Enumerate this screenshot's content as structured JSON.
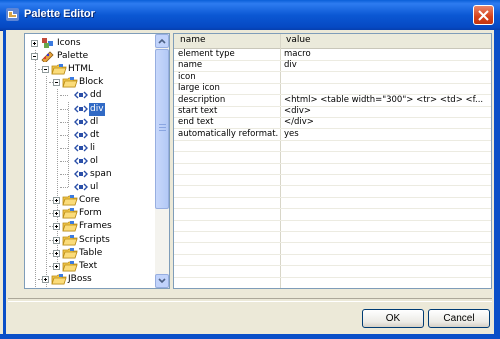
{
  "window": {
    "title": "Palette Editor"
  },
  "tree": {
    "items": [
      {
        "label": "Icons"
      },
      {
        "label": "Palette"
      },
      {
        "label": "HTML"
      },
      {
        "label": "Block"
      },
      {
        "label": "dd"
      },
      {
        "label": "div"
      },
      {
        "label": "dl"
      },
      {
        "label": "dt"
      },
      {
        "label": "li"
      },
      {
        "label": "ol"
      },
      {
        "label": "span"
      },
      {
        "label": "ul"
      },
      {
        "label": "Core"
      },
      {
        "label": "Form"
      },
      {
        "label": "Frames"
      },
      {
        "label": "Scripts"
      },
      {
        "label": "Table"
      },
      {
        "label": "Text"
      },
      {
        "label": "JBoss"
      }
    ],
    "selected": "div"
  },
  "properties": {
    "headers": {
      "name": "name",
      "value": "value"
    },
    "rows": [
      {
        "name": "element type",
        "value": "macro"
      },
      {
        "name": "name",
        "value": "div"
      },
      {
        "name": "icon",
        "value": ""
      },
      {
        "name": "large icon",
        "value": ""
      },
      {
        "name": "description",
        "value": "<html>  <table width=\"300\">   <tr>    <td>  <f..."
      },
      {
        "name": "start text",
        "value": "<div>"
      },
      {
        "name": "end text",
        "value": "</div>"
      },
      {
        "name": "automatically reformat...",
        "value": "yes"
      }
    ]
  },
  "buttons": {
    "ok": "OK",
    "cancel": "Cancel"
  },
  "colors": {
    "titlebar": "#0b58d4",
    "selection": "#316ac5",
    "dialog_bg": "#ece9d8"
  }
}
